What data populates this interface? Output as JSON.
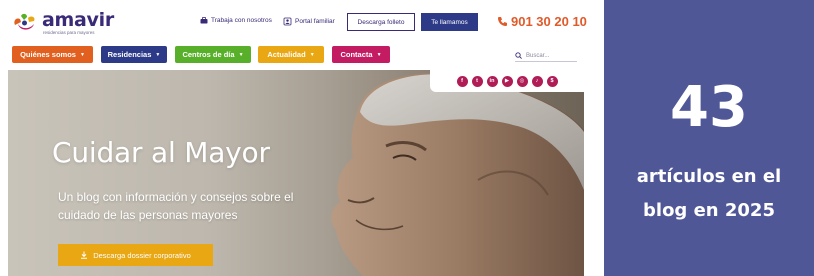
{
  "site": {
    "logo": {
      "name": "amavir",
      "tagline": "residencias para mayores"
    },
    "top_links": {
      "work": "Trabaja con nosotros",
      "portal": "Portal familiar"
    },
    "buttons": {
      "folleto": "Descarga folleto",
      "call": "Te llamamos"
    },
    "phone": "901 30 20 10",
    "nav": [
      {
        "label": "Quiénes somos",
        "color": "#e2601f"
      },
      {
        "label": "Residencias",
        "color": "#2d3a88"
      },
      {
        "label": "Centros de día",
        "color": "#58b02a"
      },
      {
        "label": "Actualidad",
        "color": "#e8a713"
      },
      {
        "label": "Contacta",
        "color": "#c31c63"
      }
    ],
    "search": {
      "placeholder": "Buscar..."
    },
    "social": [
      {
        "icon": "facebook-icon",
        "glyph": "f"
      },
      {
        "icon": "twitter-icon",
        "glyph": "t"
      },
      {
        "icon": "linkedin-icon",
        "glyph": "in"
      },
      {
        "icon": "youtube-icon",
        "glyph": "▶"
      },
      {
        "icon": "instagram-icon",
        "glyph": "◎"
      },
      {
        "icon": "tiktok-icon",
        "glyph": "♪"
      },
      {
        "icon": "money-icon",
        "glyph": "$"
      }
    ],
    "hero": {
      "title": "Cuidar al Mayor",
      "subtitle": "Un blog con información y consejos sobre el cuidado de las personas mayores",
      "button": "Descarga dossier corporativo"
    }
  },
  "stat": {
    "number": "43",
    "line1": "artículos en el",
    "line2": "blog en 2025"
  },
  "colors": {
    "brand_purple": "#3a2a78",
    "navy": "#2d3a88",
    "phone_orange": "#e05a2a",
    "social_magenta": "#b01c56",
    "stat_bg": "#4f5797"
  }
}
